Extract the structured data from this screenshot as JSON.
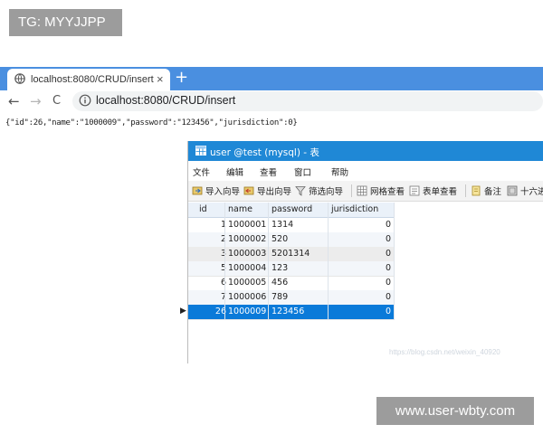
{
  "tags": {
    "top_left": "TG: MYYJJPP",
    "bottom_right": "www.user-wbty.com"
  },
  "browser": {
    "tab_title": "localhost:8080/CRUD/insert",
    "tab_close": "×",
    "new_tab": "+",
    "back": "←",
    "forward": "→",
    "reload": "C",
    "url": "localhost:8080/CRUD/insert"
  },
  "page": {
    "json_output": "{\"id\":26,\"name\":\"1000009\",\"password\":\"123456\",\"jurisdiction\":0}"
  },
  "navicat": {
    "title": "user @test (mysql) - 表",
    "menu": [
      "文件",
      "编辑",
      "查看",
      "窗口",
      "帮助"
    ],
    "toolbar": {
      "import": "导入向导",
      "export": "导出向导",
      "filter": "筛选向导",
      "grid_view": "网格查看",
      "form_view": "表单查看",
      "memo": "备注",
      "hex": "十六进"
    },
    "columns": [
      "id",
      "name",
      "password",
      "jurisdiction"
    ],
    "rows": [
      {
        "id": "1",
        "name": "1000001",
        "password": "1314",
        "jurisdiction": "0"
      },
      {
        "id": "2",
        "name": "1000002",
        "password": "520",
        "jurisdiction": "0"
      },
      {
        "id": "3",
        "name": "1000003",
        "password": "5201314",
        "jurisdiction": "0"
      },
      {
        "id": "5",
        "name": "1000004",
        "password": "123",
        "jurisdiction": "0"
      },
      {
        "id": "6",
        "name": "1000005",
        "password": "456",
        "jurisdiction": "0"
      },
      {
        "id": "7",
        "name": "1000006",
        "password": "789",
        "jurisdiction": "0"
      },
      {
        "id": "26",
        "name": "1000009",
        "password": "123456",
        "jurisdiction": "0"
      }
    ],
    "row_marker": "▶",
    "faint_watermark": "https://blog.csdn.net/weixin_40920"
  },
  "colors": {
    "tabbar": "#4a8fe0",
    "title_bar": "#1f88d6",
    "selected_row": "#0a7ad9"
  }
}
